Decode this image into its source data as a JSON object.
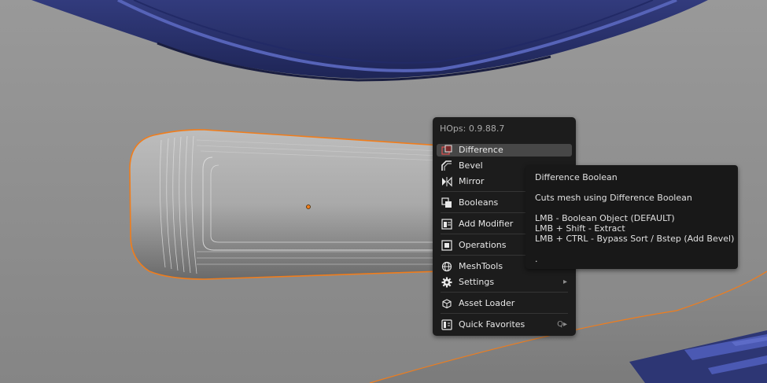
{
  "menu": {
    "title": "HOps: 0.9.88.7",
    "items": [
      {
        "label": "Difference",
        "icon": "difference-icon"
      },
      {
        "label": "Bevel",
        "icon": "bevel-icon"
      },
      {
        "label": "Mirror",
        "icon": "mirror-icon"
      },
      {
        "label": "Booleans",
        "icon": "booleans-icon"
      },
      {
        "label": "Add Modifier",
        "icon": "add-modifier-icon"
      },
      {
        "label": "Operations",
        "icon": "operations-icon"
      },
      {
        "label": "MeshTools",
        "icon": "meshtools-icon"
      },
      {
        "label": "Settings",
        "icon": "gear-icon",
        "submenu_arrow": "▸"
      },
      {
        "label": "Asset Loader",
        "icon": "asset-loader-icon"
      },
      {
        "label": "Quick Favorites",
        "icon": "quick-favorites-icon",
        "shortcut": "Q▸"
      }
    ]
  },
  "tooltip": {
    "title": "Difference Boolean",
    "description": "Cuts mesh using Difference Boolean",
    "lines": [
      "LMB - Boolean Object (DEFAULT)",
      "LMB + Shift - Extract",
      "LMB + CTRL - Bypass Sort / Bstep (Add Bevel)"
    ],
    "footer": "."
  },
  "colors": {
    "selection_outline": "#f07d1c",
    "menu_bg": "#1c1c1c",
    "active_item": "#474747",
    "blue_mesh": "#2a3370"
  }
}
